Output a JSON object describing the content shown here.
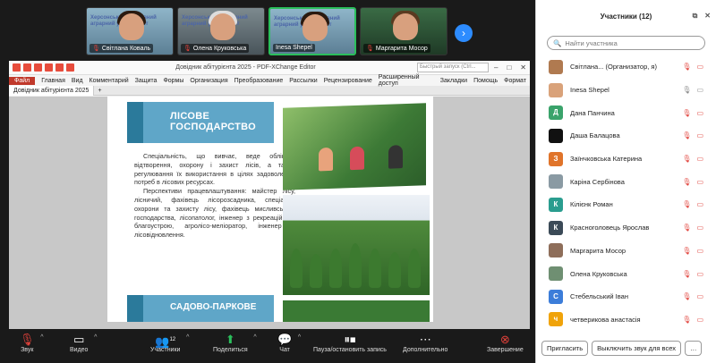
{
  "tiles": [
    {
      "name": "Світлана Коваль",
      "banner": "Херсонський державний аграрний університет"
    },
    {
      "name": "Олена Круковська",
      "banner": "Херсонський державний аграрний університет"
    },
    {
      "name": "Inesa Shepel",
      "banner": "Херсонський державний аграрний університет"
    },
    {
      "name": "Маргарита Мосор",
      "banner": ""
    }
  ],
  "editor": {
    "title": "Довідник абітурієнта 2025 - PDF-XChange Editor",
    "search_placeholder": "Быстрый запуск (Ctrl...",
    "menu": [
      "Файл",
      "Главная",
      "Вид",
      "Комментарий",
      "Защита",
      "Формы",
      "Организация",
      "Преобразование",
      "Рассылки",
      "Рецензирование",
      "Расширенный доступ",
      "Закладки",
      "Помощь",
      "Формат"
    ],
    "tab": "Довідник абітурієнта 2025"
  },
  "document": {
    "heading": "ЛІСОВЕ ГОСПОДАРСТВО",
    "p1": "Спеціальність, що вивчає, веде облік і відтворення, охорону і захист лісів, а також регулювання їх використання в цілях задоволення потреб в лісових ресурсах.",
    "p2": "Перспективи працевлаштування: майстер лісу, лісничий, фахівець лісорозсадника, спеціаліст охорони та захисту лісу, фахівець мисливського господарства, лісопатолог, інженер з рекреаційного благоустрою, агролісо-меліоратор, інженер з лісовідновлення.",
    "heading2": "САДОВО-ПАРКОВЕ"
  },
  "toolbar": {
    "mute": "Звук",
    "video": "Видео",
    "participants": "Участники",
    "participants_count": "12",
    "share": "Поделиться",
    "chat": "Чат",
    "record": "Пауза/остановить запись",
    "more": "Дополнительно",
    "end": "Завершение"
  },
  "panel": {
    "title": "Участники (12)",
    "search_placeholder": "Найти участника",
    "invite": "Пригласить",
    "mute_all": "Выключить звук для всех",
    "participants": [
      {
        "name": "Світлана... (Организатор, я)",
        "initial": "",
        "color": "#b07a50"
      },
      {
        "name": "Inesa Shepel",
        "initial": "",
        "color": "#d9a27a"
      },
      {
        "name": "Дана Панчина",
        "initial": "Д",
        "color": "#3aa36b"
      },
      {
        "name": "Даша Балацова",
        "initial": "",
        "color": "#111111"
      },
      {
        "name": "Заїнчковська Катерина",
        "initial": "З",
        "color": "#e0742a"
      },
      {
        "name": "Каріна Сербінова",
        "initial": "",
        "color": "#8a9aa3"
      },
      {
        "name": "Кілієнк Роман",
        "initial": "К",
        "color": "#2a9d8f"
      },
      {
        "name": "Красноголовець Ярослав",
        "initial": "К",
        "color": "#3b4a57"
      },
      {
        "name": "Маргарита Мосор",
        "initial": "",
        "color": "#8e6e5a"
      },
      {
        "name": "Олена Круковська",
        "initial": "",
        "color": "#6f8f72"
      },
      {
        "name": "Стебельський Іван",
        "initial": "С",
        "color": "#3c7dd9"
      },
      {
        "name": "четверикова анастасія",
        "initial": "ч",
        "color": "#f0a30a"
      }
    ]
  }
}
